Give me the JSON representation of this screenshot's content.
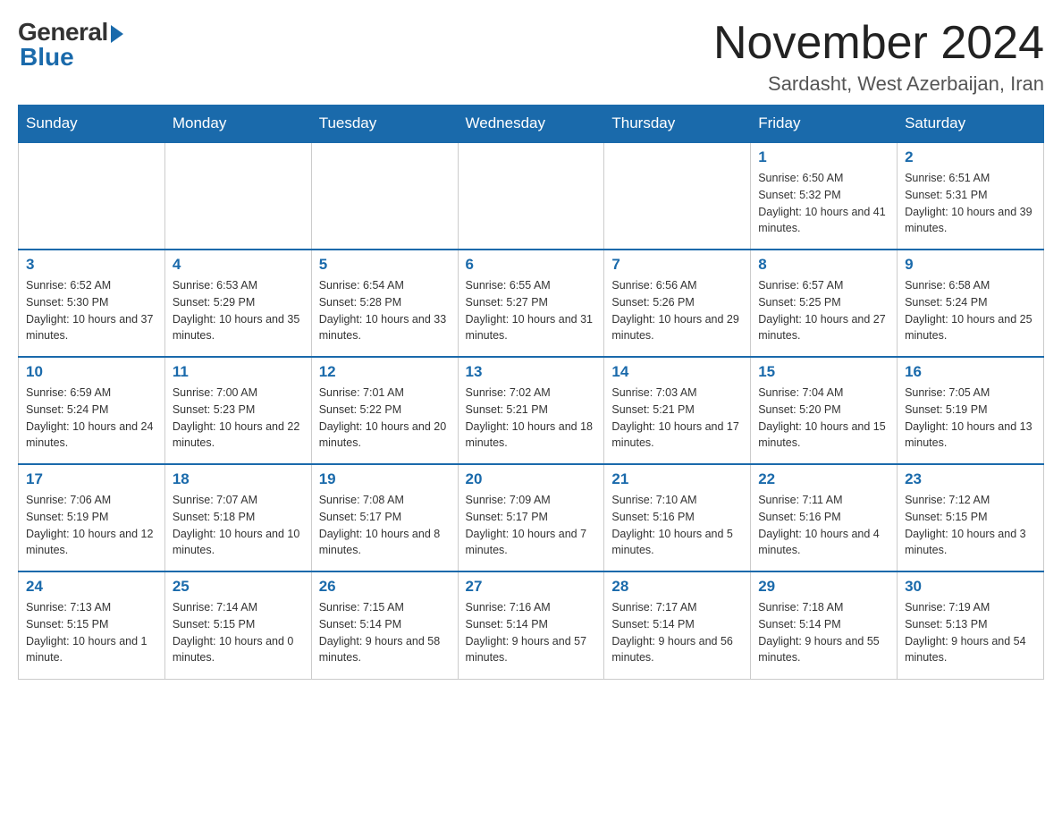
{
  "header": {
    "logo_general": "General",
    "logo_blue": "Blue",
    "title": "November 2024",
    "subtitle": "Sardasht, West Azerbaijan, Iran"
  },
  "days_of_week": [
    "Sunday",
    "Monday",
    "Tuesday",
    "Wednesday",
    "Thursday",
    "Friday",
    "Saturday"
  ],
  "weeks": [
    [
      {
        "day": "",
        "info": ""
      },
      {
        "day": "",
        "info": ""
      },
      {
        "day": "",
        "info": ""
      },
      {
        "day": "",
        "info": ""
      },
      {
        "day": "",
        "info": ""
      },
      {
        "day": "1",
        "info": "Sunrise: 6:50 AM\nSunset: 5:32 PM\nDaylight: 10 hours and 41 minutes."
      },
      {
        "day": "2",
        "info": "Sunrise: 6:51 AM\nSunset: 5:31 PM\nDaylight: 10 hours and 39 minutes."
      }
    ],
    [
      {
        "day": "3",
        "info": "Sunrise: 6:52 AM\nSunset: 5:30 PM\nDaylight: 10 hours and 37 minutes."
      },
      {
        "day": "4",
        "info": "Sunrise: 6:53 AM\nSunset: 5:29 PM\nDaylight: 10 hours and 35 minutes."
      },
      {
        "day": "5",
        "info": "Sunrise: 6:54 AM\nSunset: 5:28 PM\nDaylight: 10 hours and 33 minutes."
      },
      {
        "day": "6",
        "info": "Sunrise: 6:55 AM\nSunset: 5:27 PM\nDaylight: 10 hours and 31 minutes."
      },
      {
        "day": "7",
        "info": "Sunrise: 6:56 AM\nSunset: 5:26 PM\nDaylight: 10 hours and 29 minutes."
      },
      {
        "day": "8",
        "info": "Sunrise: 6:57 AM\nSunset: 5:25 PM\nDaylight: 10 hours and 27 minutes."
      },
      {
        "day": "9",
        "info": "Sunrise: 6:58 AM\nSunset: 5:24 PM\nDaylight: 10 hours and 25 minutes."
      }
    ],
    [
      {
        "day": "10",
        "info": "Sunrise: 6:59 AM\nSunset: 5:24 PM\nDaylight: 10 hours and 24 minutes."
      },
      {
        "day": "11",
        "info": "Sunrise: 7:00 AM\nSunset: 5:23 PM\nDaylight: 10 hours and 22 minutes."
      },
      {
        "day": "12",
        "info": "Sunrise: 7:01 AM\nSunset: 5:22 PM\nDaylight: 10 hours and 20 minutes."
      },
      {
        "day": "13",
        "info": "Sunrise: 7:02 AM\nSunset: 5:21 PM\nDaylight: 10 hours and 18 minutes."
      },
      {
        "day": "14",
        "info": "Sunrise: 7:03 AM\nSunset: 5:21 PM\nDaylight: 10 hours and 17 minutes."
      },
      {
        "day": "15",
        "info": "Sunrise: 7:04 AM\nSunset: 5:20 PM\nDaylight: 10 hours and 15 minutes."
      },
      {
        "day": "16",
        "info": "Sunrise: 7:05 AM\nSunset: 5:19 PM\nDaylight: 10 hours and 13 minutes."
      }
    ],
    [
      {
        "day": "17",
        "info": "Sunrise: 7:06 AM\nSunset: 5:19 PM\nDaylight: 10 hours and 12 minutes."
      },
      {
        "day": "18",
        "info": "Sunrise: 7:07 AM\nSunset: 5:18 PM\nDaylight: 10 hours and 10 minutes."
      },
      {
        "day": "19",
        "info": "Sunrise: 7:08 AM\nSunset: 5:17 PM\nDaylight: 10 hours and 8 minutes."
      },
      {
        "day": "20",
        "info": "Sunrise: 7:09 AM\nSunset: 5:17 PM\nDaylight: 10 hours and 7 minutes."
      },
      {
        "day": "21",
        "info": "Sunrise: 7:10 AM\nSunset: 5:16 PM\nDaylight: 10 hours and 5 minutes."
      },
      {
        "day": "22",
        "info": "Sunrise: 7:11 AM\nSunset: 5:16 PM\nDaylight: 10 hours and 4 minutes."
      },
      {
        "day": "23",
        "info": "Sunrise: 7:12 AM\nSunset: 5:15 PM\nDaylight: 10 hours and 3 minutes."
      }
    ],
    [
      {
        "day": "24",
        "info": "Sunrise: 7:13 AM\nSunset: 5:15 PM\nDaylight: 10 hours and 1 minute."
      },
      {
        "day": "25",
        "info": "Sunrise: 7:14 AM\nSunset: 5:15 PM\nDaylight: 10 hours and 0 minutes."
      },
      {
        "day": "26",
        "info": "Sunrise: 7:15 AM\nSunset: 5:14 PM\nDaylight: 9 hours and 58 minutes."
      },
      {
        "day": "27",
        "info": "Sunrise: 7:16 AM\nSunset: 5:14 PM\nDaylight: 9 hours and 57 minutes."
      },
      {
        "day": "28",
        "info": "Sunrise: 7:17 AM\nSunset: 5:14 PM\nDaylight: 9 hours and 56 minutes."
      },
      {
        "day": "29",
        "info": "Sunrise: 7:18 AM\nSunset: 5:14 PM\nDaylight: 9 hours and 55 minutes."
      },
      {
        "day": "30",
        "info": "Sunrise: 7:19 AM\nSunset: 5:13 PM\nDaylight: 9 hours and 54 minutes."
      }
    ]
  ]
}
